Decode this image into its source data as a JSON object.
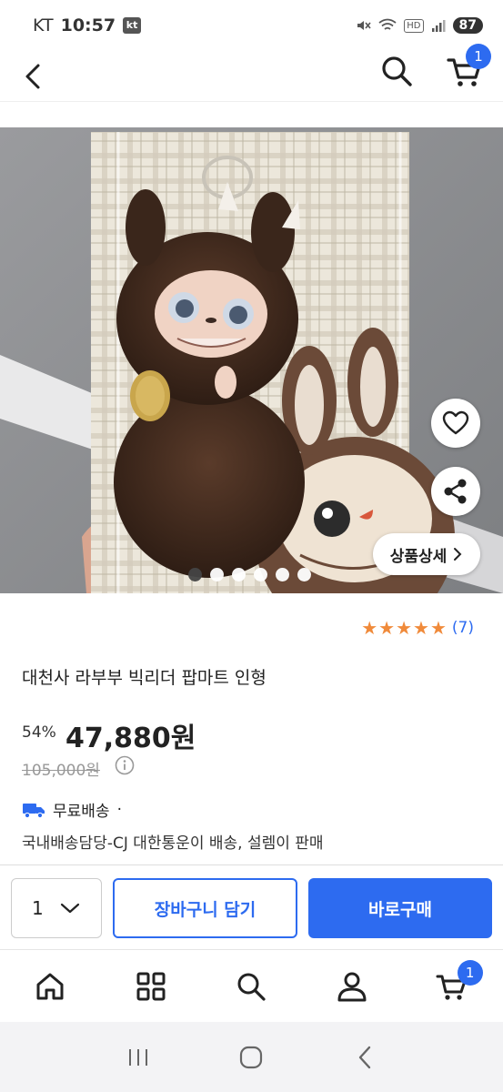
{
  "status_bar": {
    "carrier": "KT",
    "time": "10:57",
    "carrier_badge": "kt",
    "hd_label": "HD",
    "battery": "87"
  },
  "header": {
    "cart_count": "1"
  },
  "gallery": {
    "detail_button_label": "상품상세",
    "dot_count": 6,
    "active_dot": 0
  },
  "product": {
    "rating_stars": 5,
    "review_count": "(7)",
    "title": "대천사 라부부 빅리더 팝마트 인형",
    "discount": "54%",
    "price": "47,880원",
    "original_price": "105,000원",
    "shipping_label": "무료배송",
    "shipping_separator": "·",
    "shipping_desc": "국내배송담당-CJ 대한통운이 배송, 설렘이 판매"
  },
  "purchase_bar": {
    "quantity": "1",
    "add_to_cart_label": "장바구니 담기",
    "buy_now_label": "바로구매"
  },
  "bottom_nav": {
    "cart_count": "1",
    "items": [
      "home-icon",
      "category-icon",
      "search-icon",
      "user-icon",
      "cart-icon"
    ]
  },
  "colors": {
    "accent": "#2d6bf0",
    "star": "#f08a3a"
  }
}
